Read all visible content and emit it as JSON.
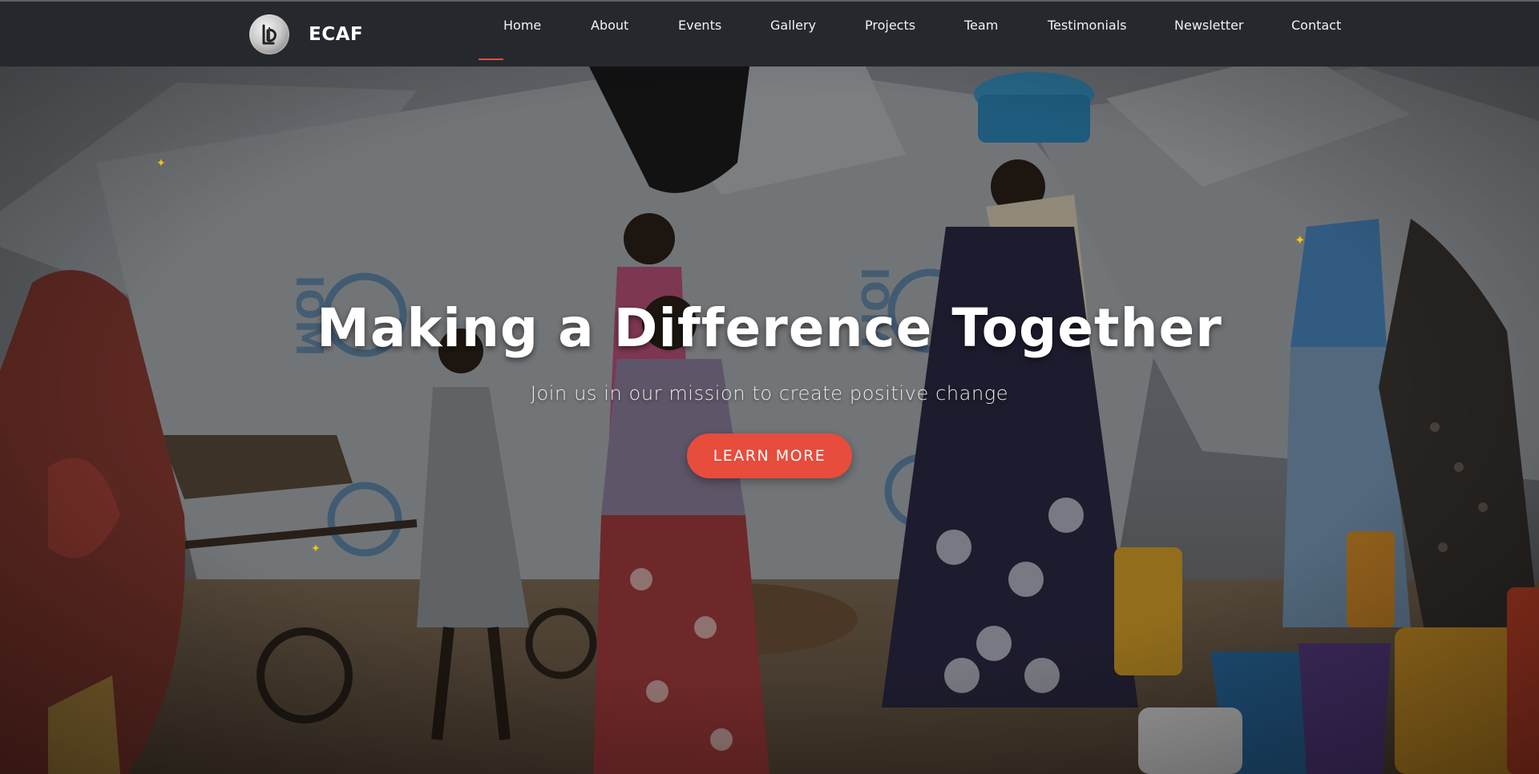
{
  "brand": {
    "name": "ECAF",
    "logo_icon": "ecaf-logo-icon"
  },
  "nav": {
    "items": [
      {
        "label": "Home",
        "active": true
      },
      {
        "label": "About"
      },
      {
        "label": "Events"
      },
      {
        "label": "Gallery"
      },
      {
        "label": "Projects"
      },
      {
        "label": "Team"
      },
      {
        "label": "Testimonials"
      },
      {
        "label": "Newsletter"
      },
      {
        "label": "Contact"
      }
    ]
  },
  "hero": {
    "title": "Making a Difference Together",
    "subtitle": "Join us in our mission to create positive change",
    "cta_label": "LEARN MORE"
  },
  "colors": {
    "accent": "#e74c3c",
    "navbar": "#25282d",
    "sparkle": "#f1c40f"
  }
}
